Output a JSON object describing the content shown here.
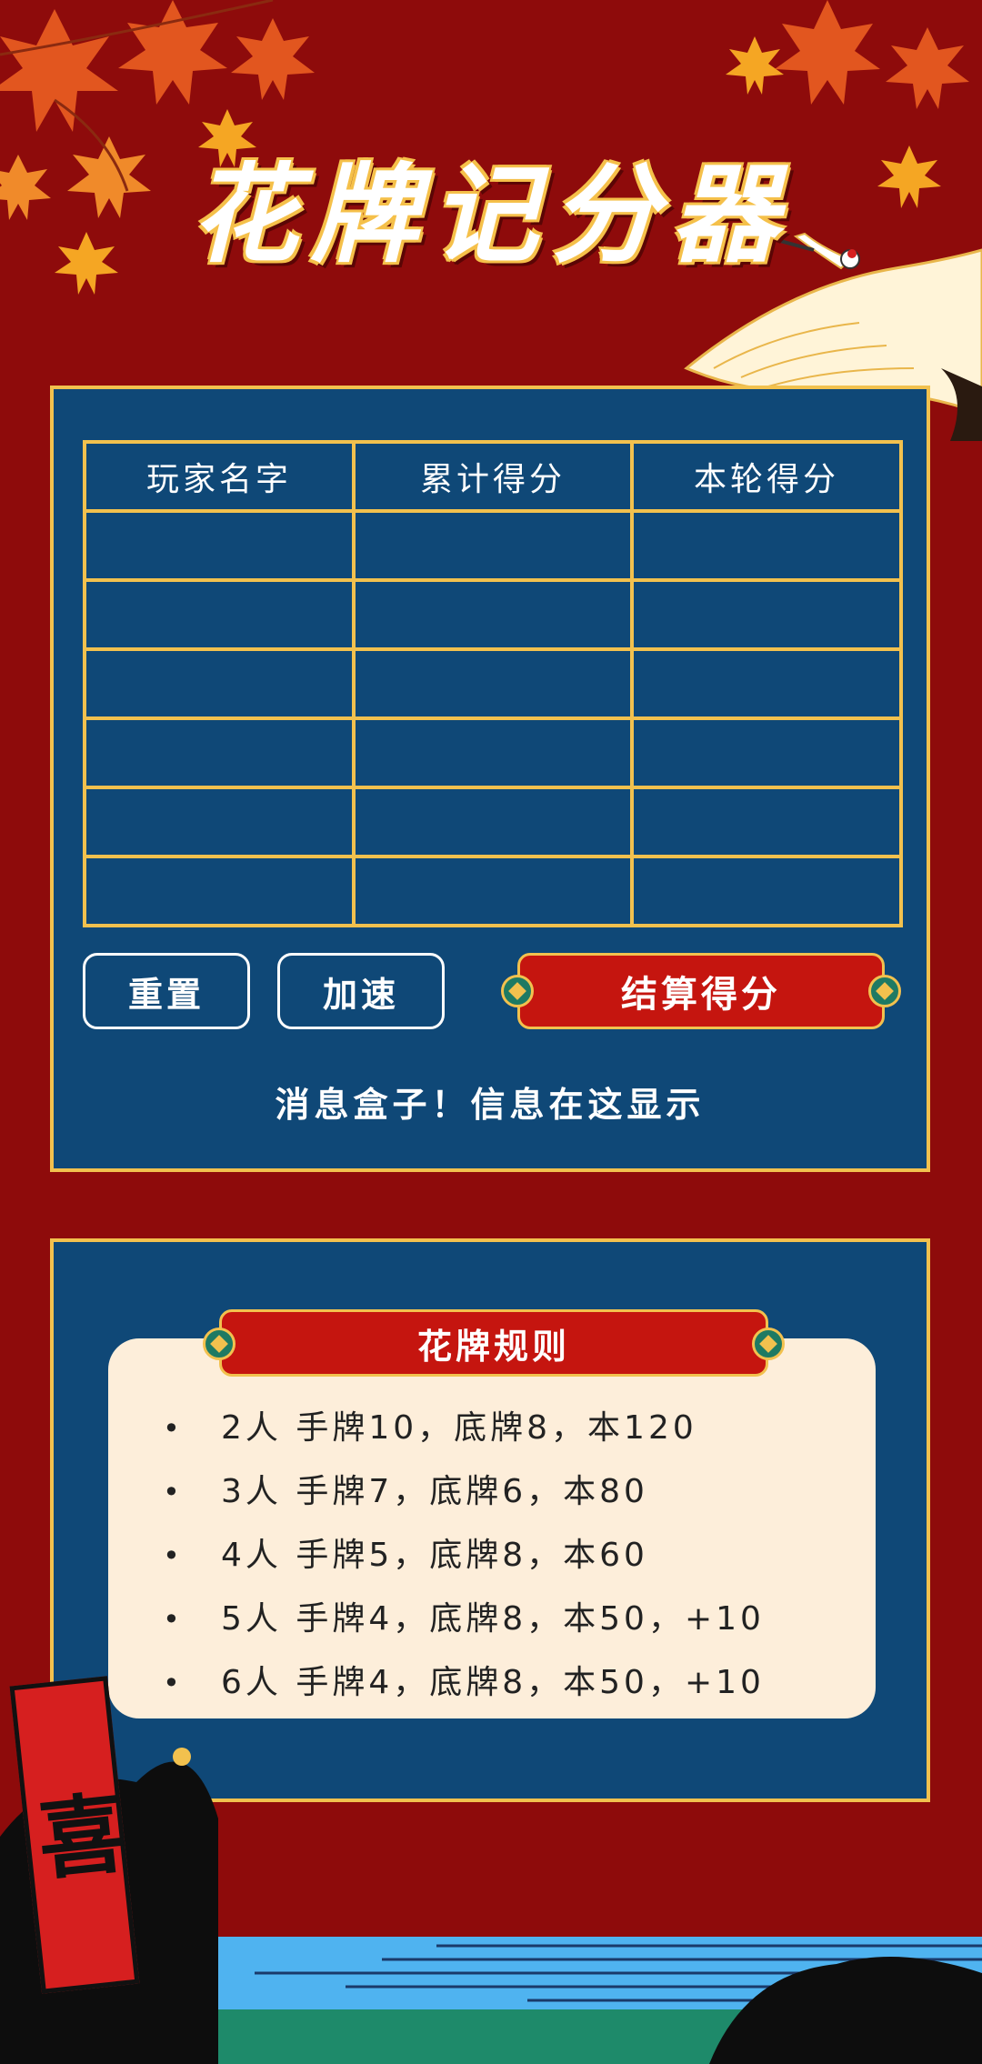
{
  "title": "花牌记分器",
  "score_table": {
    "headers": [
      "玩家名字",
      "累计得分",
      "本轮得分"
    ],
    "rows": [
      [
        "",
        "",
        ""
      ],
      [
        "",
        "",
        ""
      ],
      [
        "",
        "",
        ""
      ],
      [
        "",
        "",
        ""
      ],
      [
        "",
        "",
        ""
      ],
      [
        "",
        "",
        ""
      ]
    ]
  },
  "buttons": {
    "reset": "重置",
    "speed_up": "加速",
    "settle": "结算得分"
  },
  "message": "消息盒子！信息在这显示",
  "rules": {
    "title": "花牌规则",
    "items": [
      "2人  手牌10，底牌8，本120",
      "3人  手牌7，底牌6，本80",
      "4人  手牌5，底牌8，本60",
      "5人  手牌4，底牌8，本50，+10",
      "6人  手牌4，底牌8，本50，+10"
    ]
  },
  "decor": {
    "banner_text": "喜",
    "icons": [
      "maple-leaf-icon",
      "crane-icon",
      "mountain-icon"
    ]
  },
  "colors": {
    "background": "#8e0b0b",
    "panel": "#0f4877",
    "border_gold": "#f2c14e",
    "accent_red": "#c5150f",
    "card_cream": "#fdeeda"
  }
}
